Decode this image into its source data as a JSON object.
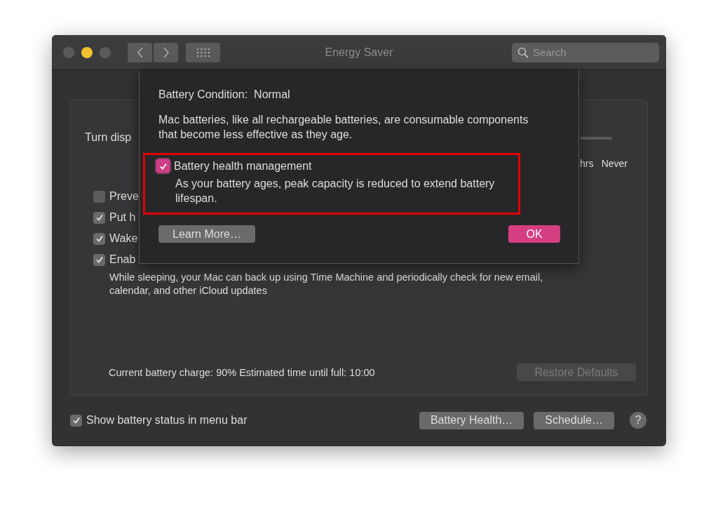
{
  "window": {
    "title": "Energy Saver",
    "search": {
      "placeholder": "Search"
    }
  },
  "background": {
    "turn_display_label": "Turn disp",
    "slider_labels": [
      "hrs",
      "Never"
    ],
    "options": [
      {
        "label": "Preve",
        "checked": false
      },
      {
        "label": "Put h",
        "checked": true
      },
      {
        "label": "Wake",
        "checked": true
      },
      {
        "label": "Enab",
        "checked": true
      }
    ],
    "option_note": "While sleeping, your Mac can back up using Time Machine and periodically check for new email, calendar, and other iCloud updates",
    "charge_status": "Current battery charge: 90% Estimated time until full: 10:00",
    "restore_button": {
      "label": "Restore Defaults",
      "disabled": true
    }
  },
  "footer": {
    "show_status": {
      "label": "Show battery status in menu bar",
      "checked": true
    },
    "buttons": [
      "Battery Health…",
      "Schedule…"
    ],
    "help": "?"
  },
  "sheet": {
    "condition_label": "Battery Condition:",
    "condition_value": "Normal",
    "description": "Mac batteries, like all rechargeable batteries, are consumable components that become less effective as they age.",
    "health": {
      "label": "Battery health management",
      "checked": true,
      "highlighted": true,
      "note": "As your battery ages, peak capacity is reduced to extend battery lifespan."
    },
    "learn_more": "Learn More…",
    "ok": "OK"
  }
}
